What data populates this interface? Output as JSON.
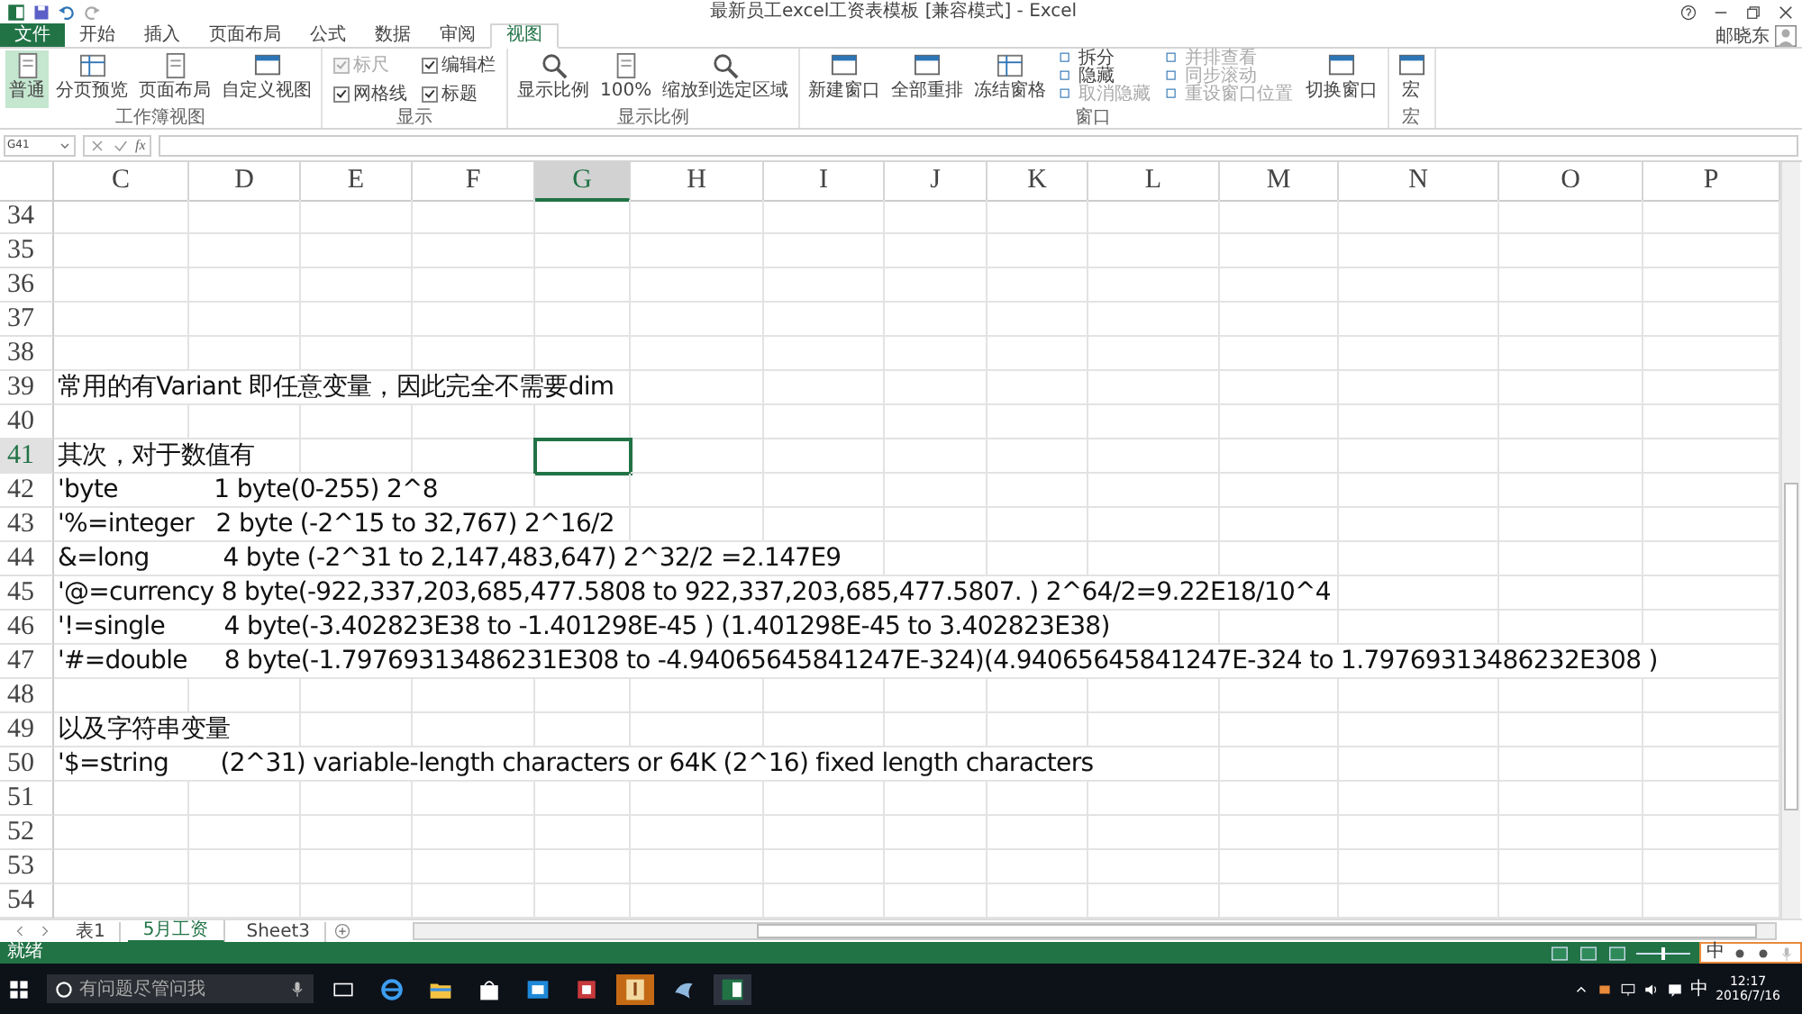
{
  "window": {
    "title": "最新员工excel工资表模板  [兼容模式] - Excel",
    "user": "邮晓东"
  },
  "ribbon_tabs": [
    {
      "label": "文件",
      "kind": "file",
      "selected": false
    },
    {
      "label": "开始",
      "kind": "tab",
      "selected": false
    },
    {
      "label": "插入",
      "kind": "tab",
      "selected": false
    },
    {
      "label": "页面布局",
      "kind": "tab",
      "selected": false
    },
    {
      "label": "公式",
      "kind": "tab",
      "selected": false
    },
    {
      "label": "数据",
      "kind": "tab",
      "selected": false
    },
    {
      "label": "审阅",
      "kind": "tab",
      "selected": false
    },
    {
      "label": "视图",
      "kind": "tab",
      "selected": true
    }
  ],
  "ribbon_groups": [
    {
      "label": "工作簿视图",
      "items": [
        {
          "kind": "large",
          "label": "普通",
          "selected": true
        },
        {
          "kind": "large",
          "label": "分页预览",
          "selected": false
        },
        {
          "kind": "large",
          "label": "页面布局",
          "selected": false
        },
        {
          "kind": "large",
          "label": "自定义视图",
          "selected": false
        }
      ]
    },
    {
      "label": "显示",
      "items": [
        {
          "kind": "checks",
          "entries": [
            {
              "label": "标尺",
              "checked": true,
              "disabled": true
            },
            {
              "label": "网格线",
              "checked": true,
              "disabled": false
            }
          ]
        },
        {
          "kind": "checks",
          "entries": [
            {
              "label": "编辑栏",
              "checked": true,
              "disabled": false
            },
            {
              "label": "标题",
              "checked": true,
              "disabled": false
            }
          ]
        }
      ]
    },
    {
      "label": "显示比例",
      "items": [
        {
          "kind": "large",
          "label": "显示比例",
          "selected": false
        },
        {
          "kind": "large",
          "label": "100%",
          "selected": false
        },
        {
          "kind": "large",
          "label": "缩放到选定区域",
          "selected": false
        }
      ]
    },
    {
      "label": "窗口",
      "items": [
        {
          "kind": "large",
          "label": "新建窗口",
          "selected": false
        },
        {
          "kind": "large",
          "label": "全部重排",
          "selected": false
        },
        {
          "kind": "large",
          "label": "冻结窗格",
          "selected": false
        },
        {
          "kind": "smalls",
          "entries": [
            {
              "label": "拆分",
              "disabled": false
            },
            {
              "label": "隐藏",
              "disabled": false
            },
            {
              "label": "取消隐藏",
              "disabled": true
            }
          ]
        },
        {
          "kind": "smalls",
          "entries": [
            {
              "label": "并排查看",
              "disabled": true
            },
            {
              "label": "同步滚动",
              "disabled": true
            },
            {
              "label": "重设窗口位置",
              "disabled": true
            }
          ]
        },
        {
          "kind": "large",
          "label": "切换窗口",
          "selected": false
        }
      ]
    },
    {
      "label": "宏",
      "items": [
        {
          "kind": "large",
          "label": "宏",
          "selected": false
        }
      ]
    }
  ],
  "formula_bar": {
    "name_box": "G41",
    "fx": "fx"
  },
  "columns": [
    {
      "label": "C",
      "selected": false
    },
    {
      "label": "D",
      "selected": false
    },
    {
      "label": "E",
      "selected": false
    },
    {
      "label": "F",
      "selected": false
    },
    {
      "label": "G",
      "selected": true
    },
    {
      "label": "H",
      "selected": false
    },
    {
      "label": "I",
      "selected": false
    },
    {
      "label": "J",
      "selected": false
    },
    {
      "label": "K",
      "selected": false
    },
    {
      "label": "L",
      "selected": false
    },
    {
      "label": "M",
      "selected": false
    },
    {
      "label": "N",
      "selected": false
    },
    {
      "label": "O",
      "selected": false
    },
    {
      "label": "P",
      "selected": false
    }
  ],
  "rows": [
    {
      "number": "34",
      "selected": false
    },
    {
      "number": "35",
      "selected": false
    },
    {
      "number": "36",
      "selected": false
    },
    {
      "number": "37",
      "selected": false
    },
    {
      "number": "38",
      "selected": false
    },
    {
      "number": "39",
      "selected": false,
      "text": "常用的有Variant 即任意变量，因此完全不需要dim"
    },
    {
      "number": "40",
      "selected": false
    },
    {
      "number": "41",
      "selected": true,
      "text": "其次，对于数值有"
    },
    {
      "number": "42",
      "selected": false,
      "text": "'byte             1 byte(0-255) 2^8"
    },
    {
      "number": "43",
      "selected": false,
      "text": "'%=integer   2 byte (-2^15 to 32,767) 2^16/2"
    },
    {
      "number": "44",
      "selected": false,
      "text": "&=long          4 byte (-2^31 to 2,147,483,647) 2^32/2 =2.147E9"
    },
    {
      "number": "45",
      "selected": false,
      "text": "'@=currency 8 byte(-922,337,203,685,477.5808 to 922,337,203,685,477.5807. ) 2^64/2=9.22E18/10^4"
    },
    {
      "number": "46",
      "selected": false,
      "text": "'!=single        4 byte(-3.402823E38 to -1.401298E-45 ) (1.401298E-45 to 3.402823E38)"
    },
    {
      "number": "47",
      "selected": false,
      "text": "'#=double     8 byte(-1.79769313486231E308 to -4.94065645841247E-324)(4.94065645841247E-324 to 1.79769313486232E308 )"
    },
    {
      "number": "48",
      "selected": false
    },
    {
      "number": "49",
      "selected": false,
      "text": "以及字符串变量"
    },
    {
      "number": "50",
      "selected": false,
      "text": "'$=string       (2^31) variable-length characters or 64K (2^16) fixed length characters"
    },
    {
      "number": "51",
      "selected": false
    },
    {
      "number": "52",
      "selected": false
    },
    {
      "number": "53",
      "selected": false
    },
    {
      "number": "54",
      "selected": false
    }
  ],
  "sheet_tabs": [
    {
      "label": "表1",
      "selected": false
    },
    {
      "label": "5月工资",
      "selected": true
    },
    {
      "label": "Sheet3",
      "selected": false
    }
  ],
  "status_bar": {
    "text": "就绪",
    "ime": "中",
    "zoom": {
      "level": 0.5
    }
  },
  "taskbar": {
    "search_placeholder": "有问题尽管问我",
    "tray_ime": "中",
    "time": "12:17",
    "date": "2016/7/16"
  }
}
